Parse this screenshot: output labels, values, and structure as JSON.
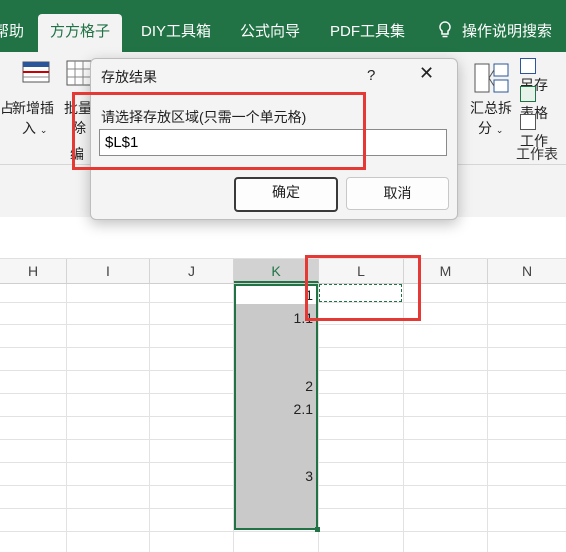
{
  "tabs": [
    {
      "label": "帮助",
      "partial": "帮助"
    },
    {
      "label": "方方格子",
      "active": true
    },
    {
      "label": "DIY工具箱"
    },
    {
      "label": "公式向导"
    },
    {
      "label": "PDF工具集"
    },
    {
      "label": "操作说明搜索"
    }
  ],
  "ribbon": {
    "left_partial": "占",
    "new_insert": "新增插",
    "new_insert2": "入",
    "batch": "批量",
    "batch_del": "除",
    "edit_partial": "编",
    "summarize": "汇总拆",
    "summarize2": "分",
    "save_as": "另存",
    "table": "表格",
    "work": "工作",
    "worksheet_group": "工作表"
  },
  "dialog": {
    "title": "存放结果",
    "help": "?",
    "prompt": "请选择存放区域(只需一个单元格)",
    "input_value": "$L$1",
    "ok": "确定",
    "cancel": "取消"
  },
  "columns": [
    "H",
    "I",
    "J",
    "K",
    "L",
    "M",
    "N"
  ],
  "selected_column": "K",
  "k_values": [
    "1",
    "1.1",
    "2",
    "2.1",
    "3"
  ],
  "colors": {
    "accent": "#217346",
    "annotation": "#e53935",
    "selection": "#c9c9c9"
  }
}
